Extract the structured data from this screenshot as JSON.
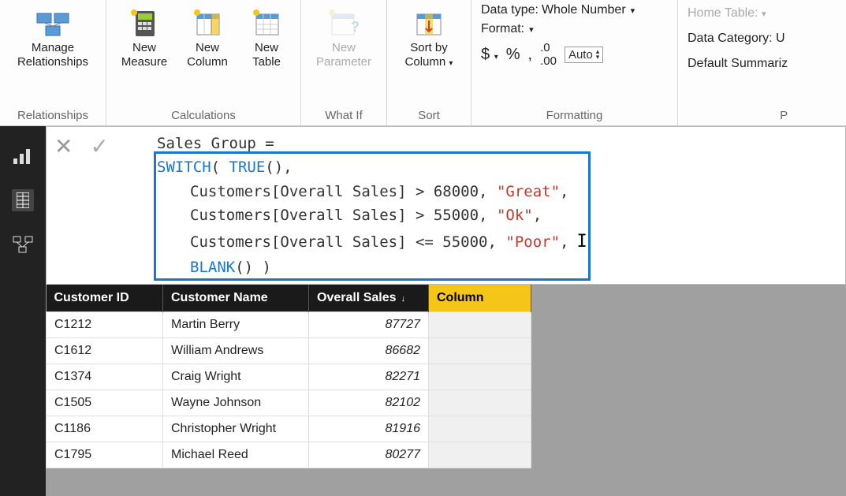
{
  "ribbon": {
    "relationships": {
      "label": "Relationships",
      "manage": "Manage\nRelationships"
    },
    "calculations": {
      "label": "Calculations",
      "measure": "New\nMeasure",
      "column": "New\nColumn",
      "table": "New\nTable"
    },
    "whatif": {
      "label": "What If",
      "parameter": "New\nParameter"
    },
    "sort": {
      "label": "Sort",
      "sortby": "Sort by\nColumn"
    },
    "formatting": {
      "label": "Formatting",
      "datatype_lbl": "Data type:",
      "datatype_val": "Whole Number",
      "format_lbl": "Format:",
      "dollar": "$",
      "percent": "%",
      "comma": ",",
      "decimals": ".00",
      "auto": "Auto"
    },
    "properties": {
      "label": "P",
      "home_table": "Home Table:",
      "data_category": "Data Category: U",
      "default_summ": "Default Summariz"
    }
  },
  "formula": {
    "line1_pre": "Sales Group =",
    "switch": "SWITCH",
    "true": "TRUE",
    "body1_a": "Customers[Overall Sales] > 68000, ",
    "body1_s": "\"Great\"",
    "body2_a": "Customers[Overall Sales] > 55000, ",
    "body2_s": "\"Ok\"",
    "body3_a": "Customers[Overall Sales] <= 55000, ",
    "body3_s": "\"Poor\"",
    "blank": "BLANK"
  },
  "table": {
    "headers": {
      "id": "Customer ID",
      "name": "Customer Name",
      "sales": "Overall Sales",
      "col": "Column"
    },
    "rows": [
      {
        "id": "C1212",
        "name": "Martin Berry",
        "sales": "87727"
      },
      {
        "id": "C1612",
        "name": "William Andrews",
        "sales": "86682"
      },
      {
        "id": "C1374",
        "name": "Craig Wright",
        "sales": "82271"
      },
      {
        "id": "C1505",
        "name": "Wayne Johnson",
        "sales": "82102"
      },
      {
        "id": "C1186",
        "name": "Christopher Wright",
        "sales": "81916"
      },
      {
        "id": "C1795",
        "name": "Michael Reed",
        "sales": "80277"
      }
    ]
  }
}
